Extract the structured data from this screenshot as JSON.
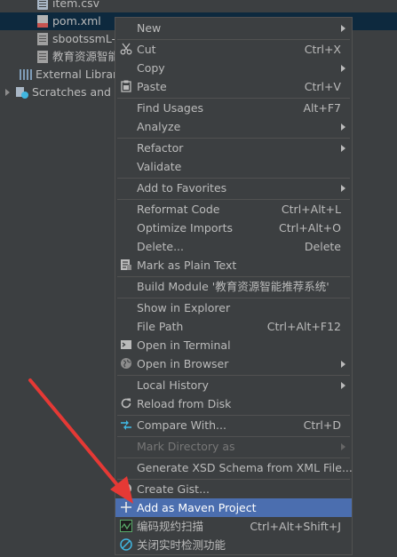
{
  "tree": [
    {
      "label": "item.csv",
      "icon": "csv-file-icon"
    },
    {
      "label": "pom.xml",
      "icon": "maven-file-icon"
    },
    {
      "label": "sbootssmL-",
      "icon": "iml-file-icon"
    },
    {
      "label": "教育资源智能",
      "icon": "iml-file-icon"
    },
    {
      "label": "External Librari",
      "icon": "libraries-icon"
    },
    {
      "label": "Scratches and C",
      "icon": "scratches-icon"
    }
  ],
  "menu": {
    "new": {
      "label": "New"
    },
    "cut": {
      "label": "Cut",
      "shortcut": "Ctrl+X",
      "icon": "scissors-icon"
    },
    "copy": {
      "label": "Copy"
    },
    "paste": {
      "label": "Paste",
      "shortcut": "Ctrl+V",
      "icon": "clipboard-icon"
    },
    "find_usages": {
      "label": "Find Usages",
      "shortcut": "Alt+F7"
    },
    "analyze": {
      "label": "Analyze"
    },
    "refactor": {
      "label": "Refactor"
    },
    "validate": {
      "label": "Validate"
    },
    "add_to_favorites": {
      "label": "Add to Favorites"
    },
    "reformat_code": {
      "label": "Reformat Code",
      "shortcut": "Ctrl+Alt+L"
    },
    "optimize_imports": {
      "label": "Optimize Imports",
      "shortcut": "Ctrl+Alt+O"
    },
    "delete": {
      "label": "Delete...",
      "shortcut": "Delete"
    },
    "mark_plain_text": {
      "label": "Mark as Plain Text",
      "icon": "plain-text-icon"
    },
    "build_module": {
      "label": "Build Module '教育资源智能推荐系统'"
    },
    "show_in_explorer": {
      "label": "Show in Explorer"
    },
    "file_path": {
      "label": "File Path",
      "shortcut": "Ctrl+Alt+F12"
    },
    "open_in_terminal": {
      "label": "Open in Terminal",
      "icon": "terminal-icon"
    },
    "open_in_browser": {
      "label": "Open in Browser",
      "icon": "globe-icon"
    },
    "local_history": {
      "label": "Local History"
    },
    "reload_from_disk": {
      "label": "Reload from Disk",
      "icon": "reload-icon"
    },
    "compare_with": {
      "label": "Compare With...",
      "shortcut": "Ctrl+D",
      "icon": "compare-icon"
    },
    "mark_directory_as": {
      "label": "Mark Directory as"
    },
    "generate_xsd": {
      "label": "Generate XSD Schema from XML File..."
    },
    "create_gist": {
      "label": "Create Gist...",
      "icon": "github-icon"
    },
    "add_as_maven": {
      "label": "Add as Maven Project",
      "icon": "plus-icon"
    },
    "code_scan": {
      "label": "编码规约扫描",
      "shortcut": "Ctrl+Alt+Shift+J",
      "icon": "code-scan-icon"
    },
    "realtime_check": {
      "label": "关闭实时检测功能",
      "icon": "no-entry-icon"
    }
  },
  "colors": {
    "background": "#3c3f41",
    "highlight": "#4b6eaf",
    "tree_selection": "#0d293e",
    "annotation_arrow": "#e53935"
  }
}
